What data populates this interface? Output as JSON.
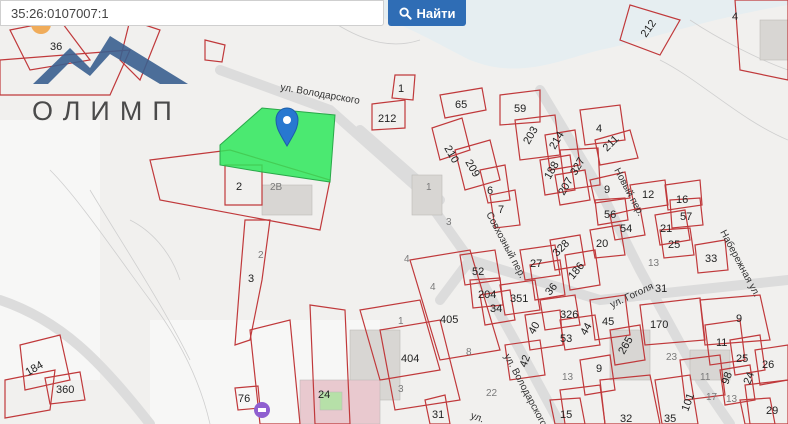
{
  "search": {
    "value": "35:26:0107007:1",
    "button_label": "Найти"
  },
  "logo": {
    "text": "ОЛИМП"
  },
  "streets": [
    "ул. Володарского",
    "Совхозный пер.",
    "ул. Володарского",
    "Новый пер.",
    "Набережная ул.",
    "ул. Гоголя",
    "ул."
  ],
  "parcel_labels": [
    "36",
    "4",
    "212",
    "1",
    "212",
    "65",
    "59",
    "210",
    "209",
    "6",
    "7",
    "203",
    "214",
    "188",
    "327",
    "207",
    "211",
    "4",
    "2",
    "2В",
    "1",
    "3",
    "9",
    "12",
    "16",
    "56",
    "57",
    "21",
    "54",
    "20",
    "25",
    "33",
    "2",
    "3",
    "52",
    "204",
    "34",
    "351",
    "27",
    "328",
    "186",
    "36",
    "31",
    "405",
    "326",
    "45",
    "170",
    "9",
    "11",
    "40",
    "44",
    "53",
    "265",
    "1",
    "404",
    "8",
    "42",
    "9",
    "25",
    "26",
    "23",
    "184",
    "360",
    "76",
    "24",
    "31",
    "22",
    "15",
    "32",
    "35",
    "101",
    "98",
    "24",
    "29",
    "4",
    "13",
    "11",
    "13",
    "17",
    "4",
    "3",
    "13"
  ],
  "colors": {
    "parcel_outline": "#c0393b",
    "selected_parcel": "#2ee85a",
    "marker": "#2878d0",
    "search_button": "#2f6db5"
  }
}
